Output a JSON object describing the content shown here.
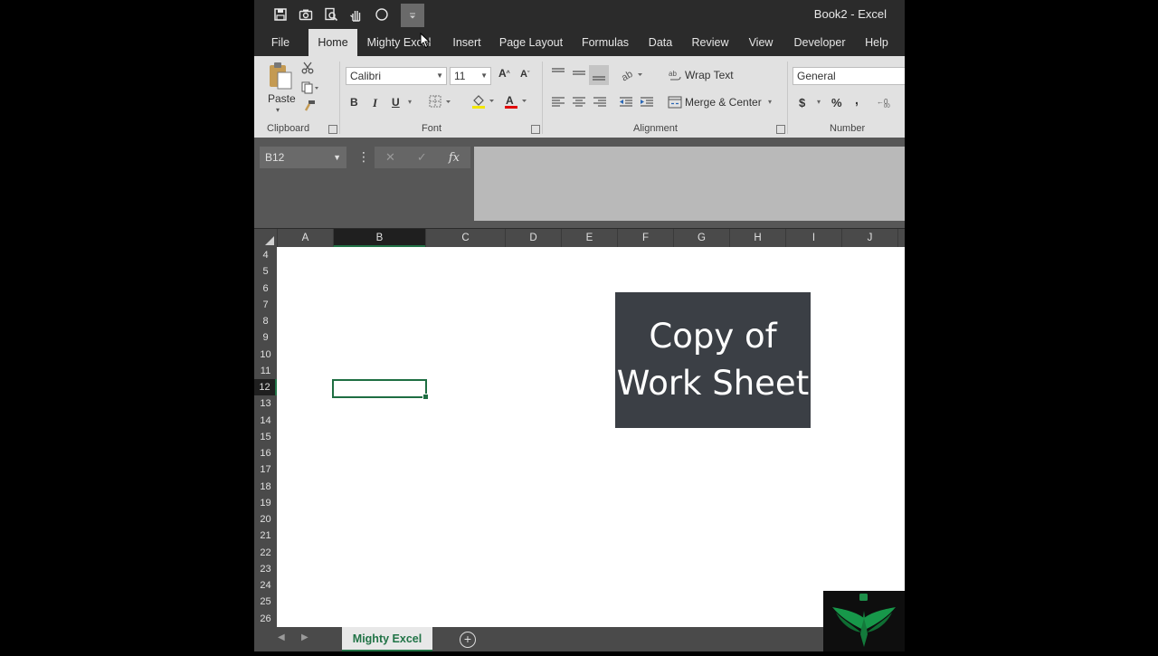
{
  "window": {
    "title": "Book2  -  Excel"
  },
  "qat": {
    "icons": [
      "save-icon",
      "camera-icon",
      "print-preview-icon",
      "touch-mode-icon",
      "circle-icon",
      "customize-qat-icon"
    ]
  },
  "menu": {
    "tabs": [
      "File",
      "Home",
      "Mighty Excel",
      "Insert",
      "Page Layout",
      "Formulas",
      "Data",
      "Review",
      "View",
      "Developer",
      "Help"
    ],
    "active": "Home"
  },
  "ribbon": {
    "clipboard": {
      "label": "Clipboard",
      "paste": "Paste"
    },
    "font": {
      "label": "Font",
      "name": "Calibri",
      "size": "11",
      "bold": "B",
      "italic": "I",
      "underline": "U"
    },
    "alignment": {
      "label": "Alignment",
      "wrap_text": "Wrap Text",
      "merge_center": "Merge & Center"
    },
    "number": {
      "label": "Number",
      "format": "General",
      "currency": "$",
      "percent": "%",
      "comma": ","
    }
  },
  "formula_bar": {
    "name_box": "B12",
    "cancel": "✕",
    "enter": "✓",
    "fx": "fx",
    "value": ""
  },
  "sheet": {
    "columns": [
      "A",
      "B",
      "C",
      "D",
      "E",
      "F",
      "G",
      "H",
      "I",
      "J"
    ],
    "selected_column": "B",
    "rows": [
      "4",
      "5",
      "6",
      "7",
      "8",
      "9",
      "10",
      "11",
      "12",
      "13",
      "14",
      "15",
      "16",
      "17",
      "18",
      "19",
      "20",
      "21",
      "22",
      "23",
      "24",
      "25",
      "26"
    ],
    "selected_row": "12",
    "active_cell": "B12"
  },
  "overlay": {
    "line1": "Copy of",
    "line2": "Work Sheet"
  },
  "sheet_tabs": {
    "tabs": [
      "Mighty Excel"
    ],
    "active": "Mighty Excel",
    "add": "+"
  },
  "colors": {
    "accent": "#217346",
    "overlay_bg": "#3b3f45",
    "app_bg": "#2b2b2b",
    "ribbon_bg": "#e1e1e1"
  }
}
